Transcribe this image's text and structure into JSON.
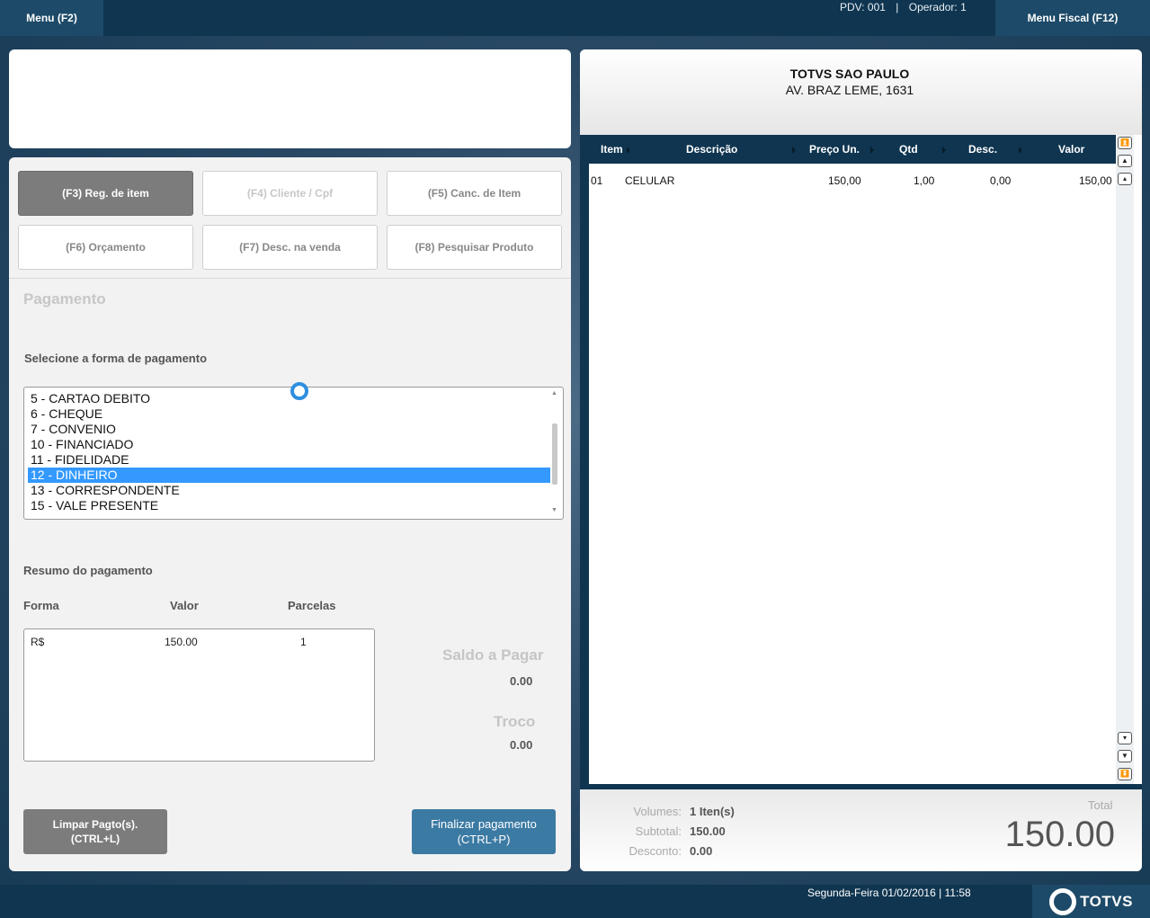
{
  "topbar": {
    "menu_left": "Menu (F2)",
    "pdv": "PDV: 001",
    "separator": "|",
    "operator": "Operador: 1",
    "menu_right": "Menu Fiscal (F12)"
  },
  "actions": {
    "reg_item": "(F3) Reg. de item",
    "cliente": "(F4) Cliente / Cpf",
    "canc_item": "(F5) Canc. de Item",
    "orcamento": "(F6) Orçamento",
    "desc_venda": "(F7) Desc. na venda",
    "pesquisar": "(F8) Pesquisar Produto"
  },
  "payment": {
    "title": "Pagamento",
    "select_label": "Selecione a forma de pagamento",
    "options": [
      "5 - CARTAO DEBITO",
      "6 - CHEQUE",
      "7 - CONVENIO",
      "10 - FINANCIADO",
      "11 - FIDELIDADE",
      "12 - DINHEIRO",
      "13 - CORRESPONDENTE",
      "15 - VALE PRESENTE"
    ],
    "selected": "12 - DINHEIRO"
  },
  "summary": {
    "title": "Resumo do pagamento",
    "columns": [
      "Forma",
      "Valor",
      "Parcelas"
    ],
    "rows": [
      {
        "forma": "R$",
        "valor": "150.00",
        "parcelas": "1"
      }
    ],
    "saldo_label": "Saldo a Pagar",
    "saldo_value": "0.00",
    "troco_label": "Troco",
    "troco_value": "0.00"
  },
  "buttons": {
    "limpar_line1": "Limpar Pagto(s).",
    "limpar_line2": "(CTRL+L)",
    "finalizar_line1": "Finalizar pagamento",
    "finalizar_line2": "(CTRL+P)"
  },
  "receipt": {
    "store_name": "TOTVS SAO PAULO",
    "store_address": "AV. BRAZ LEME, 1631",
    "columns": [
      "Item",
      "Descrição",
      "Preço Un.",
      "Qtd",
      "Desc.",
      "Valor"
    ],
    "items": [
      {
        "item": "01",
        "descricao": "CELULAR",
        "preco": "150,00",
        "qtd": "1,00",
        "desc": "0,00",
        "valor": "150,00"
      }
    ],
    "volumes_label": "Volumes:",
    "volumes_value": "1 Iten(s)",
    "subtotal_label": "Subtotal:",
    "subtotal_value": "150.00",
    "desconto_label": "Desconto:",
    "desconto_value": "0.00",
    "total_label": "Total",
    "total_value": "150.00"
  },
  "footer": {
    "datetime": "Segunda-Feira 01/02/2016 | 11:58",
    "brand": "TOTVS"
  },
  "icons": {
    "scroll_top": "double-up-arrow-icon",
    "scroll_page_up": "page-up-icon",
    "scroll_up": "up-arrow-icon",
    "scroll_down": "down-arrow-icon",
    "scroll_page_down": "page-down-icon",
    "scroll_bottom": "double-down-arrow-icon",
    "loading": "loading-ring-icon",
    "brand_logo": "totvs-logo-icon"
  },
  "colors": {
    "dark_navy": "#0f3550",
    "accent_blue": "#3b7aa3",
    "selection_blue": "#3399ff",
    "button_gray": "#7c7c7c"
  }
}
